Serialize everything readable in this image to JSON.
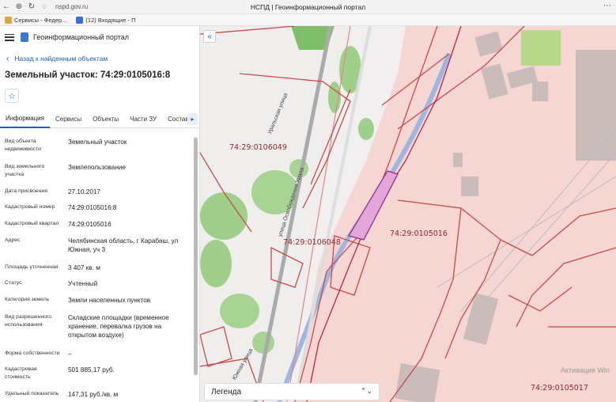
{
  "browser": {
    "url": "nspd.gov.ru",
    "title": "НСПД | Геоинформационный портал",
    "bookmarks": [
      "Сервисы - Федер...",
      "(12) Входящие - П"
    ]
  },
  "app": {
    "title": "Геоинформационный портал",
    "back_label": "Назад к найденным объектам",
    "heading": "Земельный участок: 74:29:0105016:8",
    "tabs": [
      "Информация",
      "Сервисы",
      "Объекты",
      "Части ЗУ",
      "Состав"
    ],
    "active_tab": "Информация"
  },
  "info": [
    {
      "key": "Вид объекта недвижимости",
      "value": "Земельный участок"
    },
    {
      "key": "Вид земельного участка",
      "value": "Землепользование"
    },
    {
      "key": "Дата присвоения",
      "value": "27.10.2017"
    },
    {
      "key": "Кадастровый номер",
      "value": "74:29:0105016:8"
    },
    {
      "key": "Кадастровый квартал",
      "value": "74:29:0105016"
    },
    {
      "key": "Адрес",
      "value": "Челябинская область, г Карабаш, ул Южная, уч 3"
    },
    {
      "key": "Площадь уточненная",
      "value": "3 407 кв. м"
    },
    {
      "key": "Статус",
      "value": "Учтенный"
    },
    {
      "key": "Категория земель",
      "value": "Земли населенных пунктов"
    },
    {
      "key": "Вид разрешенного использования",
      "value": "Складские площадки (временное хранение, перевалка грузов на открытом воздухе)"
    },
    {
      "key": "Форма собственности",
      "value": "–"
    },
    {
      "key": "Кадастровая стоимость",
      "value": "501 885,17 руб."
    },
    {
      "key": "Удельный показатель",
      "value": "147,31 руб./кв. м"
    }
  ],
  "map": {
    "labels": [
      "74:29:0106049",
      "74:29:0106048",
      "74:29:0105016",
      "74:29:0105017"
    ],
    "streets": [
      "Уральская улица",
      "улица Освобождения Урала",
      "Южная улица"
    ],
    "legend_label": "Легенда",
    "activation_text": "Активация Win"
  }
}
